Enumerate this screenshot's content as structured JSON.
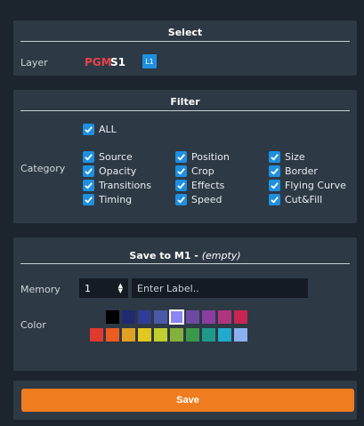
{
  "select": {
    "title": "Select",
    "layer_label": "Layer",
    "pgm": "PGM",
    "s1": "S1",
    "l1": "L1",
    "colors": {
      "pgm": "#e8414c",
      "badge": "#1f8fe0"
    }
  },
  "filter": {
    "title": "Filter",
    "all": "ALL",
    "category_label": "Category",
    "items": [
      "Source",
      "Position",
      "Size",
      "Opacity",
      "Crop",
      "Border",
      "Transitions",
      "Effects",
      "Flying Curve",
      "Timing",
      "Speed",
      "Cut&Fill"
    ]
  },
  "save_to": {
    "title_main": "Save to M1 - ",
    "title_note": "(empty)",
    "memory_label": "Memory",
    "memory_value": "1",
    "label_placeholder": "Enter Label..",
    "color_label": "Color",
    "colors_row1": [
      "#000000",
      "#1f2a70",
      "#2f3d99",
      "#4a5aa8",
      "#8b86f0",
      "#6c4aa3",
      "#8a3ea0",
      "#b0357f",
      "#c82652"
    ],
    "colors_row2": [
      "#e03a2f",
      "#ec5b1f",
      "#e0a122",
      "#e1c71e",
      "#c0cf2e",
      "#84b13b",
      "#3b9a4a",
      "#1f9a8a",
      "#22aacc",
      "#8ab0f0"
    ],
    "selected_color_index": 4
  },
  "actions": {
    "save": "Save"
  }
}
